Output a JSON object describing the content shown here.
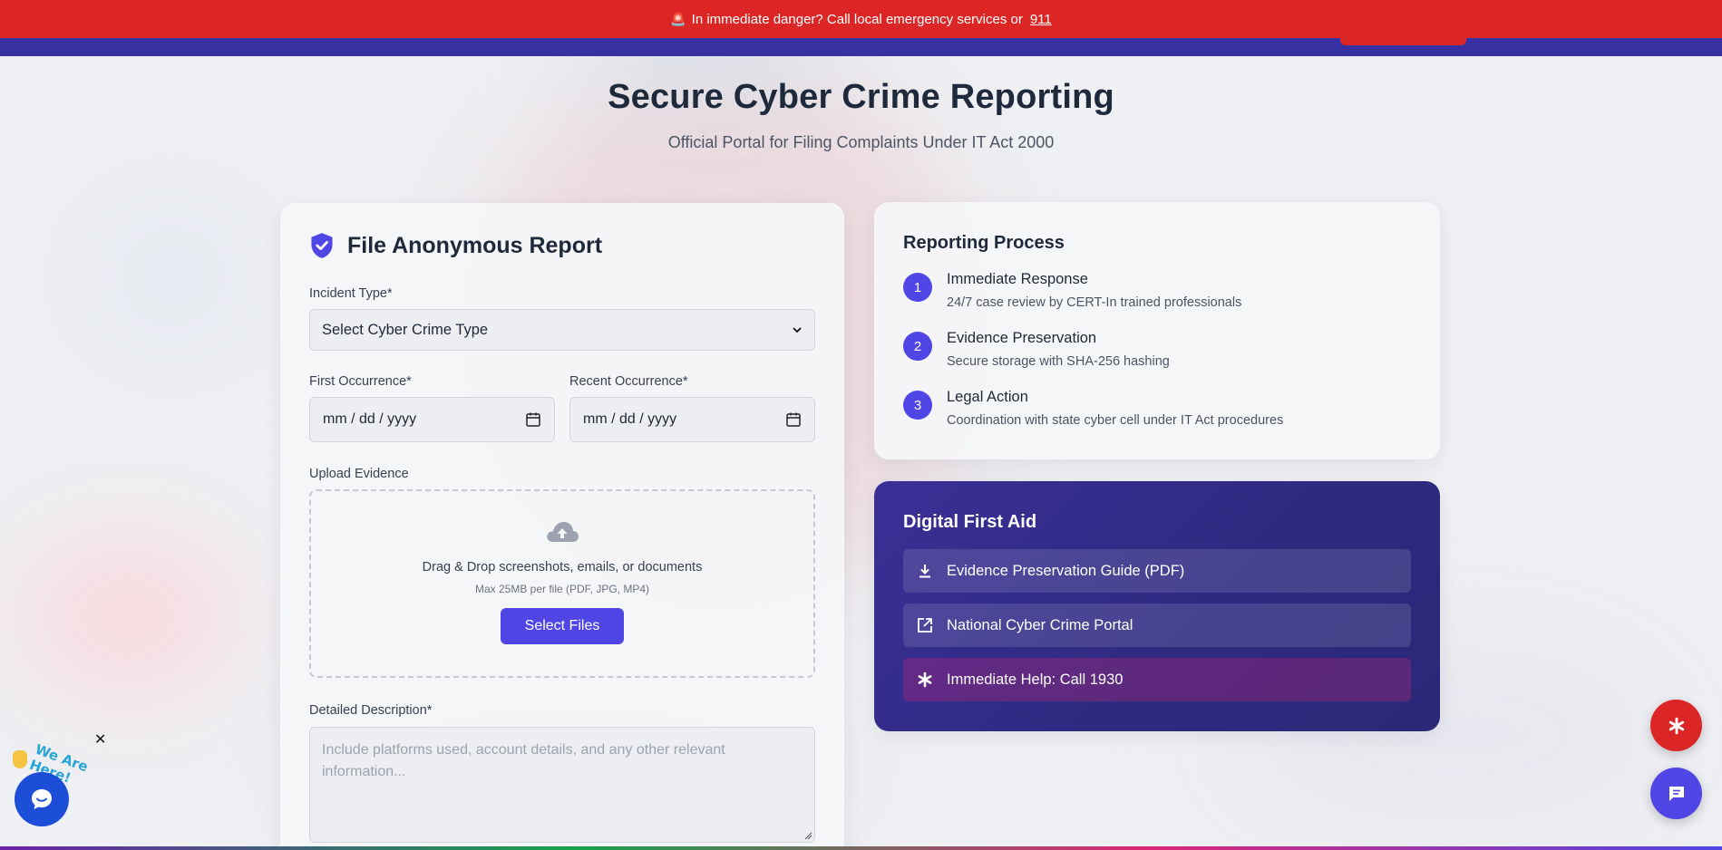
{
  "alert": {
    "siren": "🚨",
    "text": "In immediate danger? Call local emergency services or",
    "number": "911"
  },
  "hero": {
    "title": "Secure Cyber Crime Reporting",
    "subtitle": "Official Portal for Filing Complaints Under IT Act 2000"
  },
  "form": {
    "title": "File Anonymous Report",
    "incident_label": "Incident Type*",
    "incident_value": "Select Cyber Crime Type",
    "first_label": "First Occurrence*",
    "first_value": "mm / dd / yyyy",
    "recent_label": "Recent Occurrence*",
    "recent_value": "mm / dd / yyyy",
    "upload_label": "Upload Evidence",
    "drop_text": "Drag & Drop screenshots, emails, or documents",
    "drop_sub": "Max 25MB per file (PDF, JPG, MP4)",
    "select_files": "Select Files",
    "desc_label": "Detailed Description*",
    "desc_placeholder": "Include platforms used, account details, and any other relevant information..."
  },
  "process": {
    "heading": "Reporting Process",
    "steps": [
      {
        "num": "1",
        "title": "Immediate Response",
        "desc": "24/7 case review by CERT-In trained professionals"
      },
      {
        "num": "2",
        "title": "Evidence Preservation",
        "desc": "Secure storage with SHA-256 hashing"
      },
      {
        "num": "3",
        "title": "Legal Action",
        "desc": "Coordination with state cyber cell under IT Act procedures"
      }
    ]
  },
  "first_aid": {
    "heading": "Digital First Aid",
    "items": [
      {
        "label": "Evidence Preservation Guide (PDF)",
        "icon": "download-icon"
      },
      {
        "label": "National Cyber Crime Portal",
        "icon": "external-link-icon"
      },
      {
        "label": "Immediate Help: Call 1930",
        "icon": "asterisk-icon"
      }
    ]
  },
  "widget": {
    "tagline": "We Are Here!",
    "close": "✕"
  },
  "colors": {
    "alert": "#dc2626",
    "primary": "#4f46e5",
    "nav": "#3730a3",
    "aid_bg": "#2e2a7f"
  }
}
